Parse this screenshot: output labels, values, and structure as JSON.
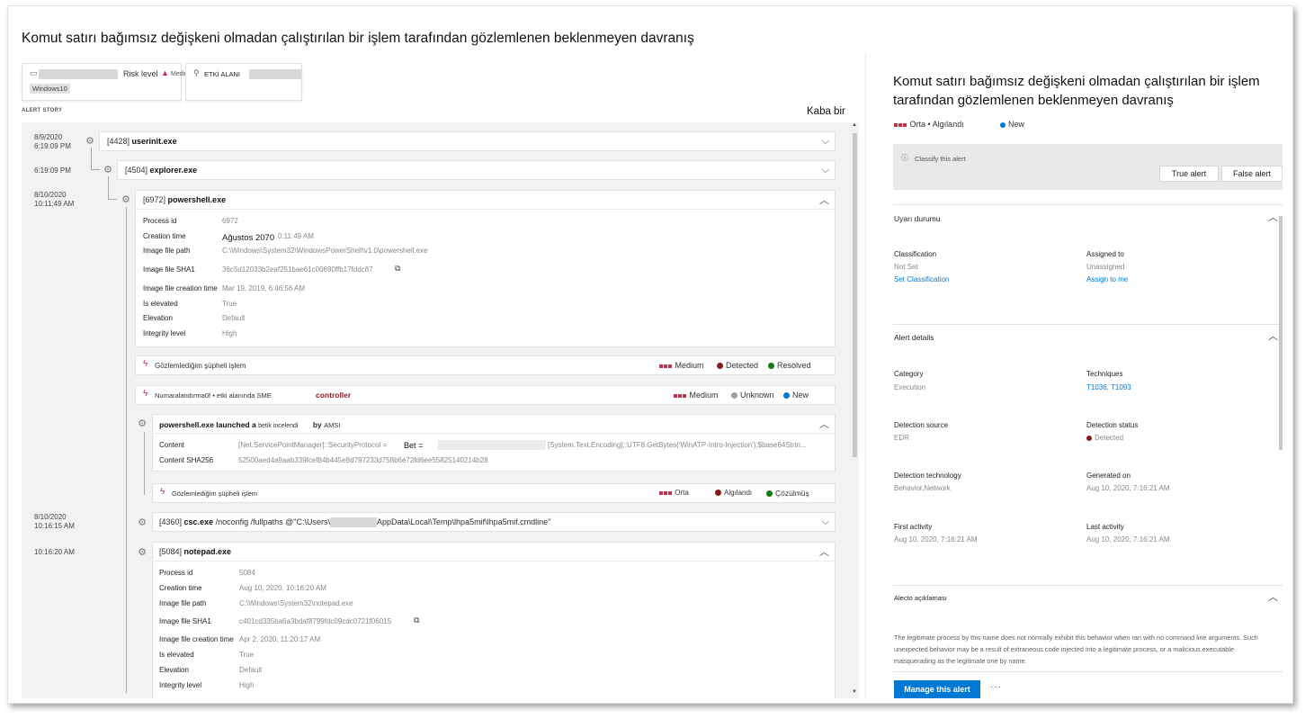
{
  "page_title": "Komut satırı bağımsız değişkeni olmadan çalıştırılan bir işlem tarafından gözlemlenen beklenmeyen davranış",
  "cards": {
    "device": {
      "risk_label": "Risk level",
      "risk_value": "Medium",
      "os_tag": "Windows10"
    },
    "user": {
      "label": "ETKİ ALANI"
    }
  },
  "alert_story_label": "ALERT STORY",
  "expand_link": "Kaba bir",
  "timeline": {
    "timestamps": {
      "t1_date": "8/9/2020",
      "t1_time": "6:19:09 PM",
      "t2_time": "6:19:09 PM",
      "t3_date": "8/10/2020",
      "t3_time": "10:11:49 AM",
      "t4_date": "8/10/2020",
      "t4_time": "10:16:15 AM",
      "t5_time": "10:16:20 AM"
    },
    "processes": [
      {
        "pid": "[4428]",
        "name": "userinit.exe"
      },
      {
        "pid": "[4504]",
        "name": "explorer.exe"
      },
      {
        "pid": "[6972]",
        "name": "powershell.exe"
      },
      {
        "pid": "[4360]",
        "name": "csc.exe",
        "args": "/noconfig /fullpaths @\"C:\\Users\\",
        "args2": "AppData\\Local\\Temp\\lhpa5mif\\lhpa5mif.cmdline\""
      },
      {
        "pid": "[5084]",
        "name": "notepad.exe"
      }
    ],
    "ps_details": {
      "process_id_label": "Process id",
      "process_id": "6972",
      "creation_time_label": "Creation time",
      "creation_time_overlay": "Ağustos 2070",
      "creation_time_tail": "0:11:49 AM",
      "image_path_label": "Image file path",
      "image_path": "C:\\Windows\\System32\\WindowsPowerShell\\v1.0\\powershell.exe",
      "sha1_label": "Image file SHA1",
      "sha1": "36c5d12033b2eaf251bae61c00690ffb17fddc87",
      "image_ct_label": "Image file creation time",
      "image_ct": "Mar 19, 2019, 6:46:56 AM",
      "elevated_label": "Is elevated",
      "elevated": "True",
      "elevation_label": "Elevation",
      "elevation": "Default",
      "integrity_label": "Integrity level",
      "integrity": "High"
    },
    "alerts": [
      {
        "title": "Gözlemlediğim şüpheli işlem",
        "severity": "Medium",
        "status": "Detected",
        "state": "Resolved"
      },
      {
        "title": "Numaralandırma0f • etki alanında SME",
        "title_bold": "controller",
        "severity": "Medium",
        "status": "Unknown",
        "state": "New"
      }
    ],
    "amsi": {
      "title_bold": "powershell.exe launched a",
      "title_small": "betik incelendi",
      "title_by": "by",
      "title_amsi": "AMSI",
      "content_label": "Content",
      "content": "[Net.ServicePointManager]::SecurityProtocol =",
      "content_overlay": "Bet =",
      "content_tail": "[System.Text.Encoding]::UTF8.GetBytes('WinATP-Intro-Injection');$base64Strin...",
      "sha256_label": "Content SHA256",
      "sha256": "52500aed4a9aab339fcef84b445e8d797233d758b6e72fd6ee55825140214b28",
      "alert": {
        "title": "Gözlemlediğim şüpheli işlem",
        "severity": "Orta",
        "status": "Algılandı",
        "state": "Çözülmüş"
      }
    },
    "np_details": {
      "process_id_label": "Process id",
      "process_id": "5084",
      "creation_time_label": "Creation time",
      "creation_time": "Aug 10, 2020, 10:16:20 AM",
      "image_path_label": "Image file path",
      "image_path": "C:\\Windows\\System32\\notepad.exe",
      "sha1_label": "Image file SHA1",
      "sha1": "c401cd335ba6a3bdaf8799fdc09cdc0721f06015",
      "image_ct_label": "Image file creation time",
      "image_ct": "Apr 2, 2020, 11:20:17 AM",
      "elevated_label": "Is elevated",
      "elevated": "True",
      "elevation_label": "Elevation",
      "elevation": "Default",
      "integrity_label": "Integrity level",
      "integrity": "High"
    }
  },
  "right_panel": {
    "title": "Komut satırı bağımsız değişkeni olmadan çalıştırılan bir işlem tarafından gözlemlenen beklenmeyen davranış",
    "severity_status": "Orta • Algılandı",
    "new_badge": "New",
    "classify_text": "Classify this alert",
    "true_alert": "True alert",
    "false_alert": "False alert",
    "state_section": "Uyarı durumu",
    "classification_label": "Classification",
    "classification_value": "Not Set",
    "set_classification": "Set Classification",
    "assigned_label": "Assigned to",
    "assigned_value": "Unassigned",
    "assign_to_me": "Assign to me",
    "details_section": "Alert details",
    "category_label": "Category",
    "category_value": "Execution",
    "techniques_label": "Techniques",
    "techniques_value": "T1036, T1093",
    "det_source_label": "Detection source",
    "det_source_value": "EDR",
    "det_status_label": "Detection status",
    "det_status_value": "Detected",
    "det_tech_label": "Detection technology",
    "det_tech_value": "Behavior,Network",
    "generated_label": "Generated on",
    "generated_value": "Aug 10, 2020, 7:16:21 AM",
    "first_label": "First activity",
    "first_value": "Aug 10, 2020, 7:16:21 AM",
    "last_label": "Last activity",
    "last_value": "Aug 10, 2020, 7:16:21 AM",
    "desc_section": "Alecto açıklaması",
    "description": "The legitimate process by this name does not normally exhibit this behavior when ran with no command line arguments. Such unexpected behavior may be a result of extraneous code injected into a legitimate process, or a malicious executable masquerading as the legitimate one by name.",
    "manage_button": "Manage this alert",
    "more": "···"
  },
  "colors": {
    "accent": "#0078d4",
    "sev_red": "#c4314b",
    "detected": "#8b1a1a",
    "resolved": "#107c10",
    "unknown": "#a19f9d",
    "new": "#0078d4"
  }
}
